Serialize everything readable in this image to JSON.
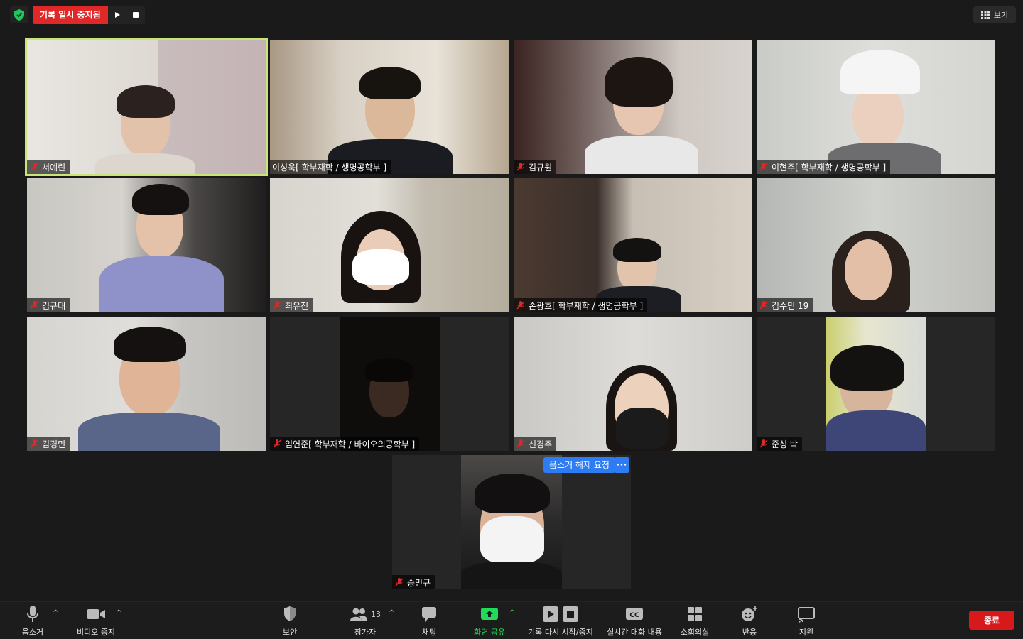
{
  "topbar": {
    "recording_status": "기록 일시 중지됨",
    "view_label": "보기"
  },
  "participants": [
    {
      "name": "서예린",
      "muted": true
    },
    {
      "name": "이성욱[ 학부재학 / 생명공학부 ]",
      "muted": false
    },
    {
      "name": "김규원",
      "muted": true
    },
    {
      "name": "이현주[ 학부재학 / 생명공학부 ]",
      "muted": true
    },
    {
      "name": "김규태",
      "muted": true
    },
    {
      "name": "최유진",
      "muted": true
    },
    {
      "name": "손광호[ 학부재학 / 생명공학부 ]",
      "muted": true
    },
    {
      "name": "김수민 19",
      "muted": true
    },
    {
      "name": "김경민",
      "muted": true
    },
    {
      "name": "임연준[ 학부재학 / 바이오의공학부 ]",
      "muted": true
    },
    {
      "name": "신경주",
      "muted": true
    },
    {
      "name": "준성 박",
      "muted": true
    },
    {
      "name": "송민규",
      "muted": true
    }
  ],
  "overlay": {
    "unmute_request": "음소거 해제 요청",
    "more": "···"
  },
  "toolbar": {
    "mute": "음소거",
    "stop_video": "비디오 중지",
    "security": "보안",
    "participants": "참가자",
    "participants_count": "13",
    "chat": "채팅",
    "share_screen": "화면 공유",
    "record": "기록 다시 시작/중지",
    "live_transcript": "실시간 대화 내용",
    "breakout": "소회의실",
    "reactions": "반응",
    "support": "지원",
    "end": "종료"
  },
  "colors": {
    "active_speaker": "#c8e678",
    "share_green": "#23d959",
    "end_red": "#d7191c",
    "unmute_blue": "#2d7cf3"
  }
}
